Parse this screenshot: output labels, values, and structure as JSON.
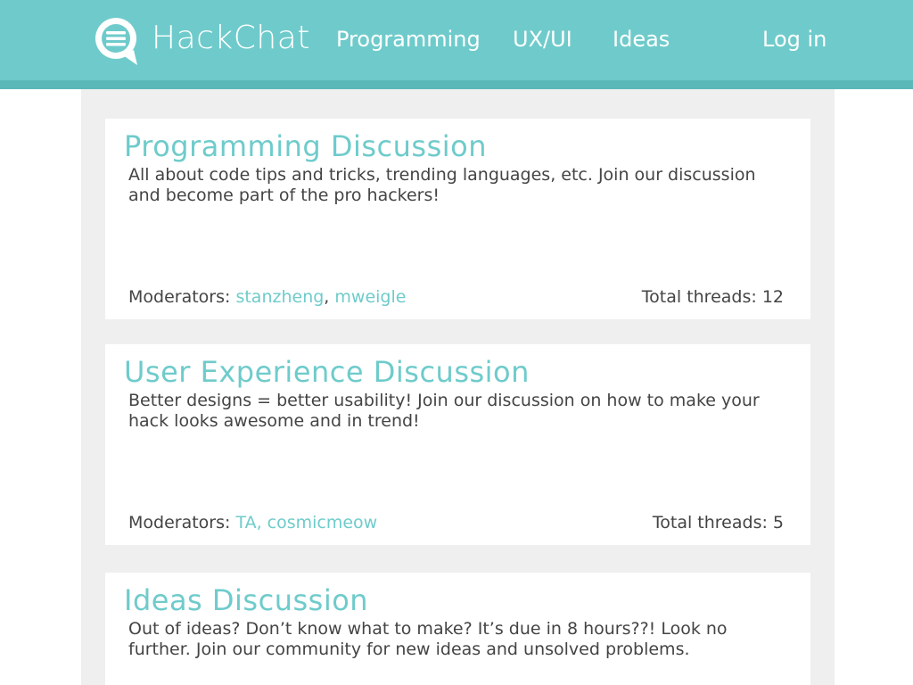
{
  "header": {
    "brand": "HackChat",
    "nav": {
      "programming": "Programming",
      "uxui": "UX/UI",
      "ideas": "Ideas",
      "login": "Log in"
    },
    "logo_icon": "chat-bubble-icon"
  },
  "colors": {
    "accent": "#6fcbcb",
    "header_stripe": "#5bb8b8",
    "content_bg": "#efefef",
    "text": "#444444"
  },
  "cards": [
    {
      "title": "Programming Discussion",
      "description": "All about code tips and tricks, trending languages, etc. Join our discussion and become part of the pro hackers!",
      "moderators_label": "Moderators: ",
      "moderators": [
        "stanzheng",
        "mweigle"
      ],
      "moderators_sep": ", ",
      "threads_label": "Total threads: 12"
    },
    {
      "title": "User Experience Discussion",
      "description": "Better designs = better usability! Join our discussion on how to make your hack looks awesome and in trend!",
      "moderators_label": "Moderators: ",
      "moderators_text": "TA, cosmicmeow",
      "threads_label": "Total threads: 5"
    },
    {
      "title": "Ideas Discussion",
      "description": "Out of ideas? Don’t know what to make? It’s due in 8 hours??! Look no further. Join our community for new ideas and unsolved problems."
    }
  ]
}
